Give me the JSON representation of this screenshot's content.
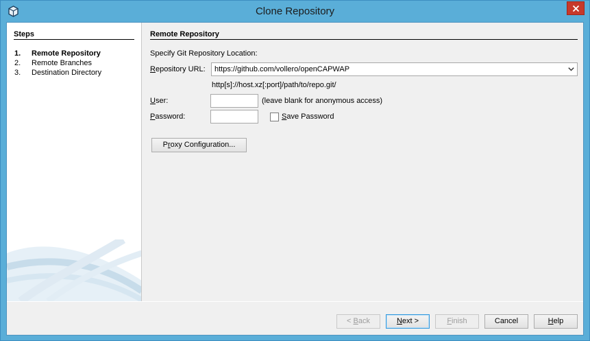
{
  "window": {
    "title": "Clone Repository"
  },
  "steps": {
    "title": "Steps",
    "items": [
      {
        "num": "1.",
        "label": "Remote Repository"
      },
      {
        "num": "2.",
        "label": "Remote Branches"
      },
      {
        "num": "3.",
        "label": "Destination Directory"
      }
    ]
  },
  "content": {
    "title": "Remote Repository",
    "intro": "Specify Git Repository Location:",
    "repo_url": {
      "label_mnemonic": "R",
      "label_rest": "epository URL:",
      "value": "https://github.com/vollero/openCAPWAP",
      "hint": "http[s]://host.xz[:port]/path/to/repo.git/"
    },
    "user": {
      "label_mnemonic": "U",
      "label_rest": "ser:",
      "value": "",
      "hint": "(leave blank for anonymous access)"
    },
    "password": {
      "label_mnemonic": "P",
      "label_rest": "assword:",
      "value": ""
    },
    "save_password": {
      "mnemonic": "S",
      "label_rest": "ave Password",
      "checked": false
    },
    "proxy_button": {
      "mnemonic": "r",
      "label_before": "P",
      "label_after": "oxy Configuration..."
    }
  },
  "footer": {
    "back": {
      "before": "< ",
      "mnemonic": "B",
      "after": "ack"
    },
    "next": {
      "mnemonic": "N",
      "after": "ext >"
    },
    "finish": {
      "mnemonic": "F",
      "after": "inish"
    },
    "cancel": {
      "label": "Cancel"
    },
    "help": {
      "mnemonic": "H",
      "after": "elp"
    }
  }
}
